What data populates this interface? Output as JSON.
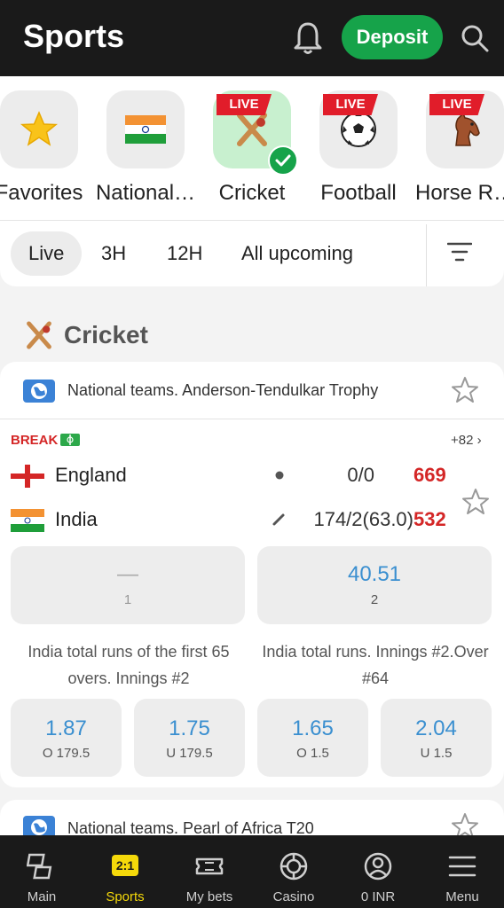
{
  "header": {
    "title": "Sports",
    "deposit_label": "Deposit"
  },
  "categories": [
    {
      "label": "Favorites",
      "live": ""
    },
    {
      "label": "National…",
      "live": ""
    },
    {
      "label": "Cricket",
      "live": "LIVE"
    },
    {
      "label": "Football",
      "live": "LIVE"
    },
    {
      "label": "Horse R…",
      "live": "LIVE"
    }
  ],
  "time_filters": [
    "Live",
    "3H",
    "12H",
    "All upcoming"
  ],
  "section": {
    "title": "Cricket"
  },
  "event": {
    "league": "National teams. Anderson-Tendulkar Trophy",
    "status": "BREAK",
    "more": "+82 ›",
    "teams": [
      {
        "name": "England",
        "score": "0/0",
        "total": "669"
      },
      {
        "name": "India",
        "score": "174/2(63.0)",
        "total": "532"
      }
    ],
    "outcomes": [
      {
        "value": "—",
        "key": "1"
      },
      {
        "value": "40.51",
        "key": "2"
      }
    ],
    "markets": [
      {
        "title": "India total runs of the first 65 overs. Innings #2",
        "odds": [
          {
            "value": "1.87",
            "key": "O 179.5"
          },
          {
            "value": "1.75",
            "key": "U 179.5"
          }
        ]
      },
      {
        "title": "India total runs. Innings #2.Over #64",
        "odds": [
          {
            "value": "1.65",
            "key": "O 1.5"
          },
          {
            "value": "2.04",
            "key": "U 1.5"
          }
        ]
      }
    ]
  },
  "next_event": {
    "league": "National teams. Pearl of Africa T20"
  },
  "bottom_nav": [
    {
      "label": "Main",
      "icon": "main-icon"
    },
    {
      "label": "Sports",
      "icon": "2:1"
    },
    {
      "label": "My bets",
      "icon": "ticket-icon"
    },
    {
      "label": "Casino",
      "icon": "chip-icon"
    },
    {
      "label": "0 INR",
      "icon": "user-icon"
    },
    {
      "label": "Menu",
      "icon": "menu-icon"
    }
  ],
  "colors": {
    "accent_green": "#16a34a",
    "live_red": "#e11d2a",
    "odds_blue": "#3a8fd0",
    "nav_active": "#f5d90a"
  }
}
